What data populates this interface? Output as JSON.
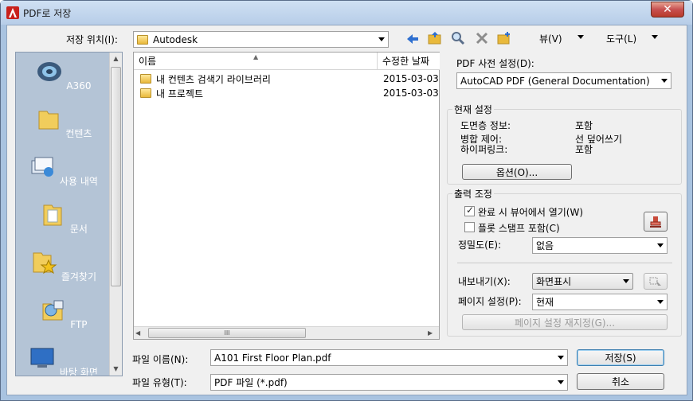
{
  "window": {
    "title": "PDF로 저장",
    "close_glyph": "✕"
  },
  "location": {
    "label": "저장 위치(I):",
    "value": "Autodesk"
  },
  "toolbar": {
    "back_icon": "back-arrow-icon",
    "view_label": "뷰(V)",
    "tools_label": "도구(L)"
  },
  "places": [
    {
      "label": "A360",
      "icon": "cloud-icon"
    },
    {
      "label": "컨텐츠",
      "icon": "folder-icon"
    },
    {
      "label": "사용 내역",
      "icon": "history-icon"
    },
    {
      "label": "문서",
      "icon": "documents-icon"
    },
    {
      "label": "즐겨찾기",
      "icon": "favorites-icon"
    },
    {
      "label": "FTP",
      "icon": "ftp-icon"
    },
    {
      "label": "바탕 화면",
      "icon": "desktop-icon"
    }
  ],
  "filelist": {
    "col_name": "이름",
    "col_date": "수정한 날짜",
    "rows": [
      {
        "name": "내 컨텐츠 검색기 라이브러리",
        "date": "2015-03-03"
      },
      {
        "name": "내 프로젝트",
        "date": "2015-03-03"
      }
    ],
    "hscroll_thumb": "III"
  },
  "pdf_preset": {
    "label": "PDF 사전 설정(D):",
    "value": "AutoCAD PDF (General Documentation)"
  },
  "current_settings": {
    "title": "현재 설정",
    "rows": [
      {
        "key": "도면층 정보:",
        "value": "포함"
      },
      {
        "key": "병합 제어:",
        "value": "선 덮어쓰기"
      },
      {
        "key": "하이퍼링크:",
        "value": "포함"
      }
    ],
    "options_button": "옵션(O)..."
  },
  "output_control": {
    "title": "출력 조정",
    "open_in_viewer": {
      "label": "완료 시 뷰어에서 열기(W)",
      "checked": true
    },
    "include_plot_stamp": {
      "label": "플롯 스탬프 포함(C)",
      "checked": false
    },
    "precision": {
      "label": "정밀도(E):",
      "value": "없음"
    },
    "export": {
      "label": "내보내기(X):",
      "value": "화면표시"
    },
    "page_setup": {
      "label": "페이지 설정(P):",
      "value": "현재"
    },
    "page_setup_override": "페이지 설정 재지정(G)..."
  },
  "filename": {
    "label": "파일 이름(N):",
    "value": "A101 First Floor Plan.pdf"
  },
  "filetype": {
    "label": "파일 유형(T):",
    "value": "PDF 파일 (*.pdf)"
  },
  "buttons": {
    "save": "저장(S)",
    "cancel": "취소"
  }
}
